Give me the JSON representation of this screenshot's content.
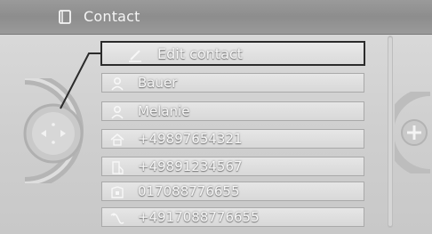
{
  "header": {
    "title": "Contact",
    "icon": "contact-book-icon"
  },
  "menu": {
    "items": [
      {
        "label": "Edit contact",
        "icon": "edit-pencil-icon",
        "selected": true
      },
      {
        "label": "Bauer",
        "icon": "person-icon"
      },
      {
        "label": "Melanie",
        "icon": "person-icon"
      },
      {
        "label": "+49897654321",
        "icon": "home-phone-icon"
      },
      {
        "label": "+49891234567",
        "icon": "office-phone-icon"
      },
      {
        "label": "017088776655",
        "icon": "phone-icon"
      },
      {
        "label": "+4917088776655",
        "icon": "mobile-phone-icon"
      }
    ]
  },
  "controller": {
    "left": "left-arrow-icon",
    "right": "right-arrow-icon",
    "plus": "plus-icon"
  },
  "colors": {
    "header_bg": "#8d8d8d",
    "selection_border": "#2b2b2b",
    "item_text": "#f7f7f7"
  }
}
